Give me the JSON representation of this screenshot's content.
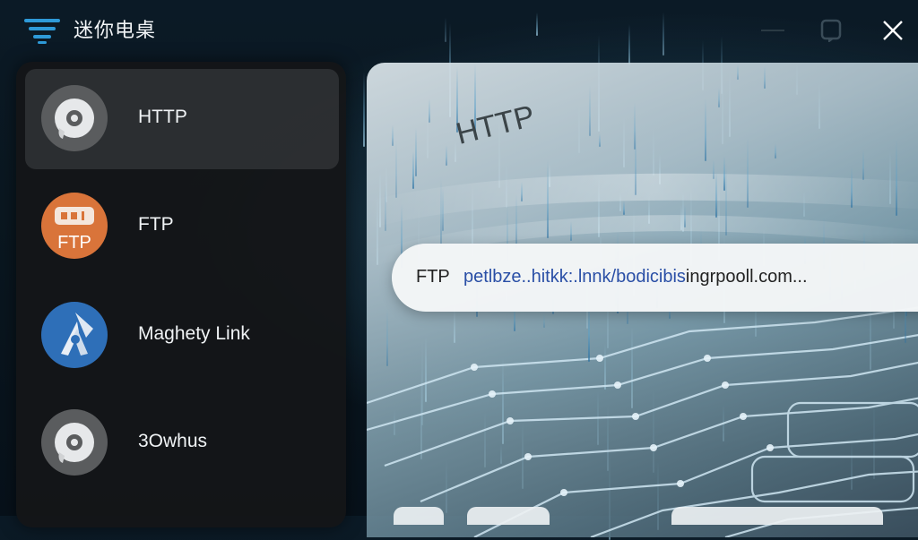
{
  "app": {
    "title": "迷你电桌",
    "menu_icon": "menu-filter-icon",
    "window_controls": [
      "minimize-icon",
      "maximize-icon",
      "close-icon"
    ]
  },
  "sidebar": {
    "items": [
      {
        "label": "HTTP",
        "icon": "disc-icon",
        "active": true
      },
      {
        "label": "FTP",
        "icon": "ftp-icon",
        "active": false
      },
      {
        "label": "Maghety Link",
        "icon": "magnet-link-icon",
        "active": false
      },
      {
        "label": "3Owhus",
        "icon": "disc-icon",
        "active": false
      }
    ]
  },
  "preview": {
    "heading": "HTTP",
    "url_bar": {
      "protocol": "FTP",
      "url_link_part": "petlbze..hitkk:.lnnk/bodicibis",
      "url_rest": "ingrpooll.com..."
    }
  },
  "colors": {
    "accent": "#2e9ad8",
    "ftp_orange": "#d9743a",
    "magnet_blue": "#2e6fb8",
    "link_blue": "#2a4fa6"
  }
}
